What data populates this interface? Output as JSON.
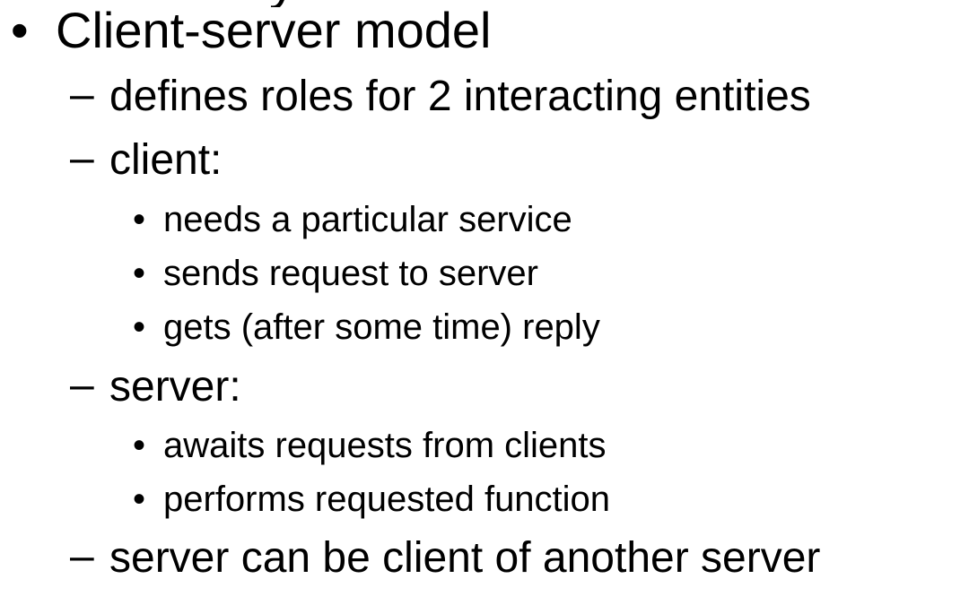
{
  "slide": {
    "clipped_title_fragment": "y",
    "bullets": [
      {
        "level": 1,
        "marker": "•",
        "text": "Client-server model"
      },
      {
        "level": 2,
        "marker": "–",
        "text": "defines roles for 2 interacting entities"
      },
      {
        "level": 2,
        "marker": "–",
        "text": "client:"
      },
      {
        "level": 3,
        "marker": "•",
        "text": "needs a particular service"
      },
      {
        "level": 3,
        "marker": "•",
        "text": "sends request to server"
      },
      {
        "level": 3,
        "marker": "•",
        "text": "gets (after some time) reply"
      },
      {
        "level": 2,
        "marker": "–",
        "text": "server:"
      },
      {
        "level": 3,
        "marker": "•",
        "text": "awaits requests from clients"
      },
      {
        "level": 3,
        "marker": "•",
        "text": "performs requested function"
      },
      {
        "level": 2,
        "marker": "–",
        "text": "server can be client of another server"
      }
    ]
  }
}
